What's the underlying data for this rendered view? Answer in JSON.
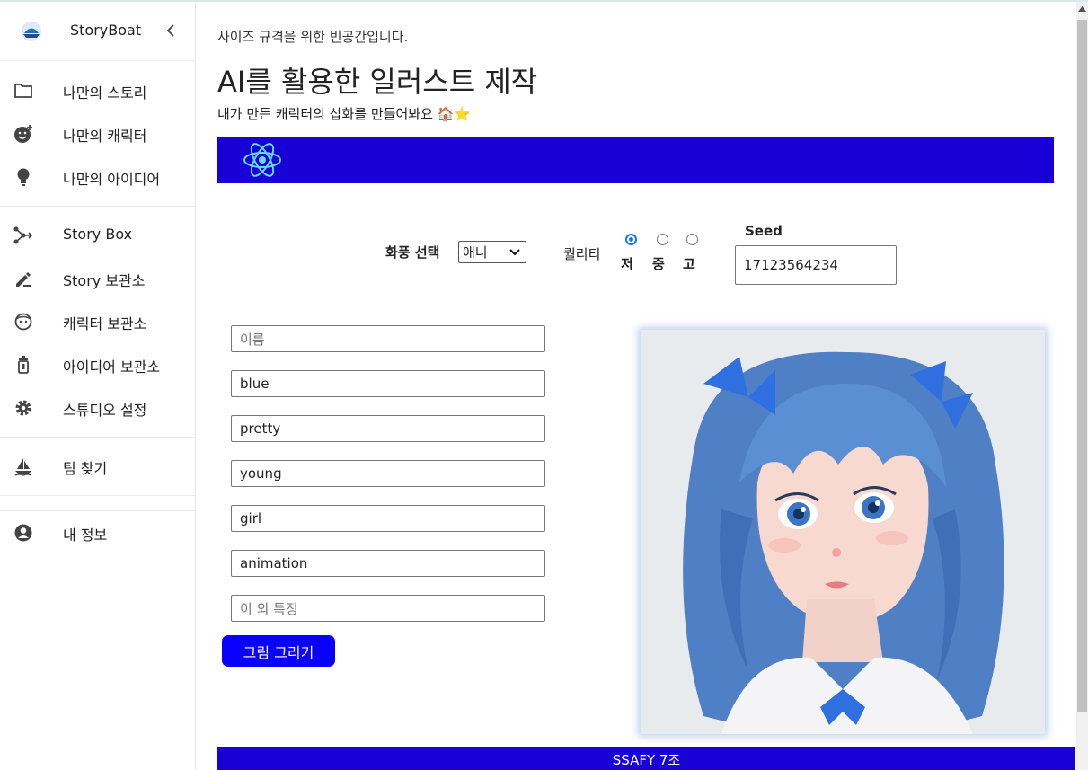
{
  "app": {
    "brand": "StoryBoat",
    "colors": {
      "banner": "#1800d6",
      "button": "#0a00ff",
      "radio_checked": "#1a73e8"
    }
  },
  "sidebar": {
    "items": [
      {
        "label": "나만의 스토리",
        "icon": "folder-icon"
      },
      {
        "label": "나만의 캐릭터",
        "icon": "add-emoji-icon"
      },
      {
        "label": "나만의 아이디어",
        "icon": "lightbulb-icon"
      },
      {
        "label": "Story Box",
        "icon": "share-nodes-icon"
      },
      {
        "label": "Story 보관소",
        "icon": "pencil-icon"
      },
      {
        "label": "캐릭터 보관소",
        "icon": "face-icon"
      },
      {
        "label": "아이디어 보관소",
        "icon": "lantern-icon"
      },
      {
        "label": "스튜디오 설정",
        "icon": "gear-icon"
      },
      {
        "label": "팀 찾기",
        "icon": "sailboat-icon"
      },
      {
        "label": "내 정보",
        "icon": "account-circle-icon"
      }
    ]
  },
  "main": {
    "note": "사이즈 규격을 위한 빈공간입니다.",
    "title": "AI를 활용한 일러스트 제작",
    "subtitle": "내가 만든 캐릭터의 삽화를 만들어봐요 🏠⭐",
    "controls": {
      "style_label": "화풍 선택",
      "style_value": "애니",
      "quality_label": "퀄리티",
      "quality_options": [
        "저",
        "중",
        "고"
      ],
      "quality_selected": "저",
      "seed_label": "Seed",
      "seed_value": "17123564234"
    },
    "fields": [
      {
        "value": "",
        "placeholder": "이름"
      },
      {
        "value": "blue",
        "placeholder": ""
      },
      {
        "value": "pretty",
        "placeholder": ""
      },
      {
        "value": "young",
        "placeholder": ""
      },
      {
        "value": "girl",
        "placeholder": ""
      },
      {
        "value": "animation",
        "placeholder": ""
      },
      {
        "value": "",
        "placeholder": "이 외 특징"
      }
    ],
    "draw_button": "그림 그리기",
    "footer": "SSAFY 7조"
  }
}
